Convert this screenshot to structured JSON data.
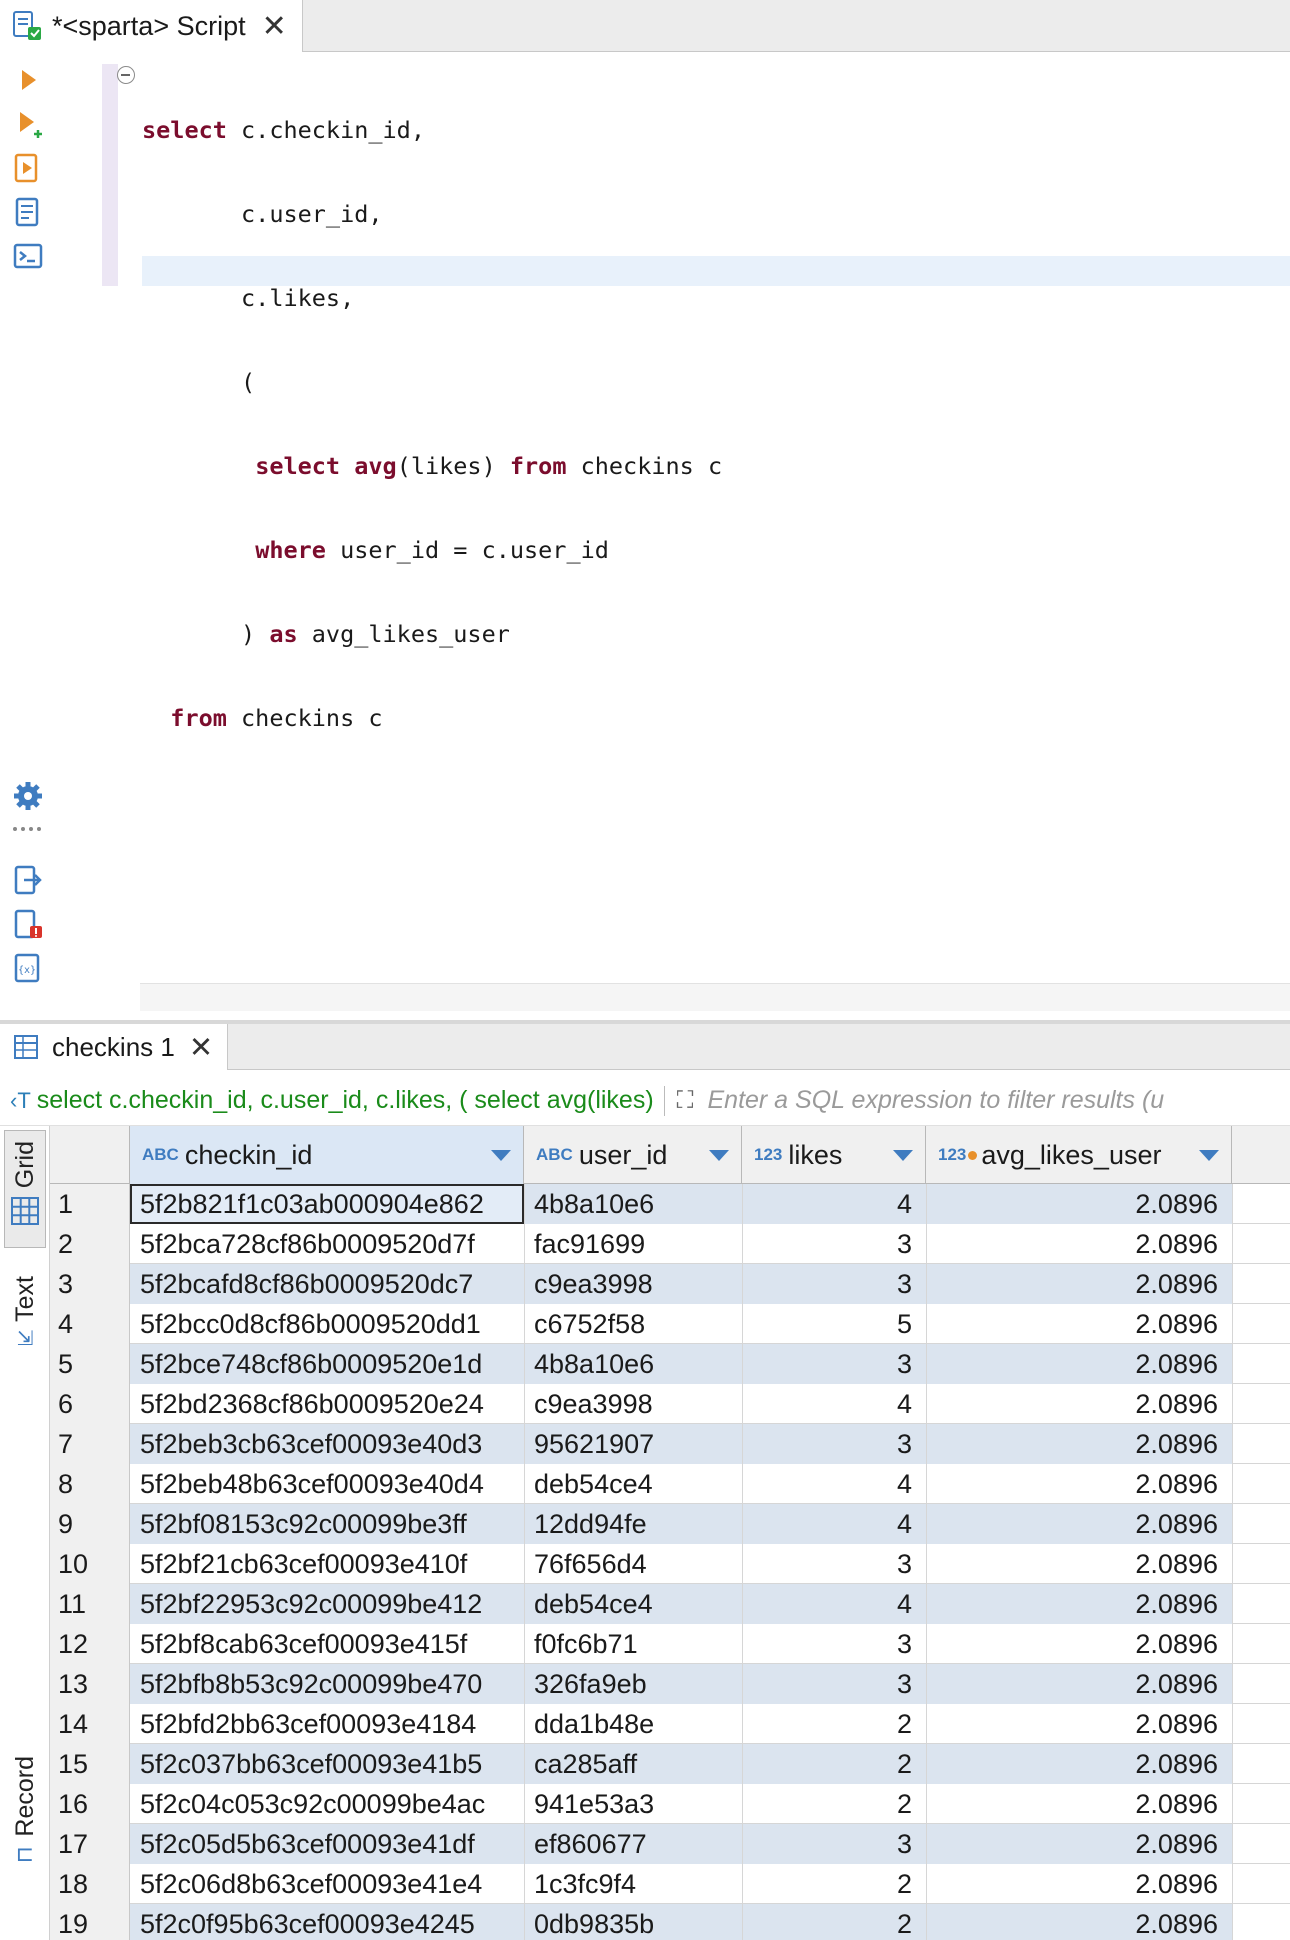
{
  "editor": {
    "tab_title": "*<sparta> Script",
    "code_lines": [
      "select c.checkin_id,",
      "       c.user_id,",
      "       c.likes,",
      "       (",
      "        select avg(likes) from checkins c",
      "        where user_id = c.user_id",
      "       ) as avg_likes_user",
      "  from checkins c"
    ]
  },
  "results": {
    "tab_title": "checkins 1",
    "query_preview": "select c.checkin_id, c.user_id, c.likes, ( select avg(likes)",
    "filter_placeholder": "Enter a SQL expression to filter results (u",
    "view_tabs": {
      "grid": "Grid",
      "text": "Text",
      "record": "Record"
    },
    "columns": [
      {
        "type": "ABC",
        "name": "checkin_id"
      },
      {
        "type": "ABC",
        "name": "user_id"
      },
      {
        "type": "123",
        "name": "likes"
      },
      {
        "type": "123",
        "name": "avg_likes_user"
      }
    ],
    "rows": [
      {
        "n": "1",
        "checkin_id": "5f2b821f1c03ab000904e862",
        "user_id": "4b8a10e6",
        "likes": "4",
        "avg": "2.0896"
      },
      {
        "n": "2",
        "checkin_id": "5f2bca728cf86b0009520d7f",
        "user_id": "fac91699",
        "likes": "3",
        "avg": "2.0896"
      },
      {
        "n": "3",
        "checkin_id": "5f2bcafd8cf86b0009520dc7",
        "user_id": "c9ea3998",
        "likes": "3",
        "avg": "2.0896"
      },
      {
        "n": "4",
        "checkin_id": "5f2bcc0d8cf86b0009520dd1",
        "user_id": "c6752f58",
        "likes": "5",
        "avg": "2.0896"
      },
      {
        "n": "5",
        "checkin_id": "5f2bce748cf86b0009520e1d",
        "user_id": "4b8a10e6",
        "likes": "3",
        "avg": "2.0896"
      },
      {
        "n": "6",
        "checkin_id": "5f2bd2368cf86b0009520e24",
        "user_id": "c9ea3998",
        "likes": "4",
        "avg": "2.0896"
      },
      {
        "n": "7",
        "checkin_id": "5f2beb3cb63cef00093e40d3",
        "user_id": "95621907",
        "likes": "3",
        "avg": "2.0896"
      },
      {
        "n": "8",
        "checkin_id": "5f2beb48b63cef00093e40d4",
        "user_id": "deb54ce4",
        "likes": "4",
        "avg": "2.0896"
      },
      {
        "n": "9",
        "checkin_id": "5f2bf08153c92c00099be3ff",
        "user_id": "12dd94fe",
        "likes": "4",
        "avg": "2.0896"
      },
      {
        "n": "10",
        "checkin_id": "5f2bf21cb63cef00093e410f",
        "user_id": "76f656d4",
        "likes": "3",
        "avg": "2.0896"
      },
      {
        "n": "11",
        "checkin_id": "5f2bf22953c92c00099be412",
        "user_id": "deb54ce4",
        "likes": "4",
        "avg": "2.0896"
      },
      {
        "n": "12",
        "checkin_id": "5f2bf8cab63cef00093e415f",
        "user_id": "f0fc6b71",
        "likes": "3",
        "avg": "2.0896"
      },
      {
        "n": "13",
        "checkin_id": "5f2bfb8b53c92c00099be470",
        "user_id": "326fa9eb",
        "likes": "3",
        "avg": "2.0896"
      },
      {
        "n": "14",
        "checkin_id": "5f2bfd2bb63cef00093e4184",
        "user_id": "dda1b48e",
        "likes": "2",
        "avg": "2.0896"
      },
      {
        "n": "15",
        "checkin_id": "5f2c037bb63cef00093e41b5",
        "user_id": "ca285aff",
        "likes": "2",
        "avg": "2.0896"
      },
      {
        "n": "16",
        "checkin_id": "5f2c04c053c92c00099be4ac",
        "user_id": "941e53a3",
        "likes": "2",
        "avg": "2.0896"
      },
      {
        "n": "17",
        "checkin_id": "5f2c05d5b63cef00093e41df",
        "user_id": "ef860677",
        "likes": "3",
        "avg": "2.0896"
      },
      {
        "n": "18",
        "checkin_id": "5f2c06d8b63cef00093e41e4",
        "user_id": "1c3fc9f4",
        "likes": "2",
        "avg": "2.0896"
      },
      {
        "n": "19",
        "checkin_id": "5f2c0f95b63cef00093e4245",
        "user_id": "0db9835b",
        "likes": "2",
        "avg": "2.0896"
      }
    ]
  },
  "icons": {
    "script_tab": "sql-script-icon",
    "execute": "execute-statement-icon",
    "execute_new": "execute-in-new-tab-icon",
    "execute_script": "execute-script-icon",
    "explain": "explain-plan-icon",
    "console": "show-console-icon",
    "settings": "gear-icon",
    "export": "export-icon",
    "problems": "problems-icon",
    "variables": "variables-icon"
  },
  "colors": {
    "keyword": "#7b0d2d",
    "accent": "#3f7cc0",
    "selected_row": "#dbe4ef",
    "filter_query": "#1a8b1a"
  }
}
